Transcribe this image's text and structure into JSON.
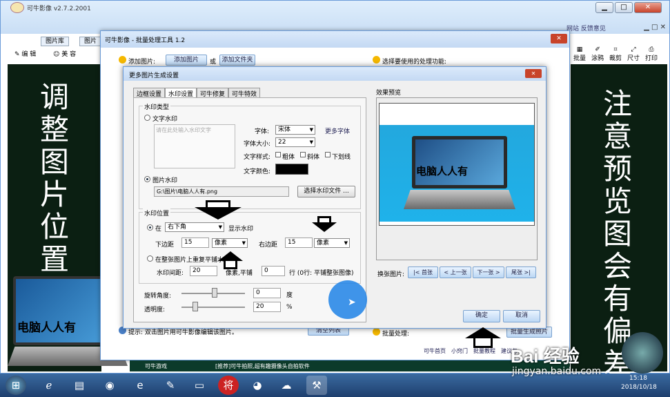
{
  "app": {
    "title": "可牛影像  v2.7.2.2001",
    "links": "网站 反馈意见",
    "controls": {
      "min": "▁",
      "max": "□",
      "close": "✕"
    }
  },
  "tabs": [
    "图片库",
    "图片"
  ],
  "tools": [
    "编 辑",
    "美 容"
  ],
  "right_tools": [
    "批量",
    "涂鸦",
    "裁剪",
    "尺寸",
    "打印"
  ],
  "left_panel": {
    "text": "调整图片位置"
  },
  "right_panel": {
    "text": "注意预览图会有偏差"
  },
  "watermark_text": "电脑人人有",
  "batch": {
    "title": "可牛影像 - 批量处理工具 1.2",
    "add_label": "添加图片:",
    "add_image_btn": "添加图片",
    "or": "或",
    "add_folder_btn": "添加文件夹",
    "choose_label": "选择要使用的处理功能:",
    "tip": "提示: 双击图片用可牛影像编辑该图片。",
    "clear_btn": "清空列表",
    "batch_label": "批量处理:",
    "batch_btn": "批量生成照片",
    "footer": [
      "可牛首页",
      "小窍门",
      "批量教程",
      "建议与"
    ]
  },
  "dialog": {
    "title": "更多图片生成设置",
    "tabs": [
      "边框设置",
      "水印设置",
      "可牛修复",
      "可牛特效"
    ],
    "wm_type": "水印类型",
    "text_wm": "文字水印",
    "text_placeholder": "请在此处输入水印文字",
    "font_lbl": "字体:",
    "font_val": "宋体",
    "more_font": "更多字体",
    "size_lbl": "字体大小:",
    "size_val": "22",
    "style_lbl": "文字样式:",
    "bold": "粗体",
    "italic": "斜体",
    "underline": "下划线",
    "color_lbl": "文字颜色:",
    "color": "#000000",
    "img_wm": "图片水印",
    "img_path": "G:\\图片\\电脑人人有.png",
    "choose_file": "选择水印文件 ...",
    "pos_lbl": "水印位置",
    "at": "在",
    "corner": "右下角",
    "show_wm": "显示水印",
    "bottom_lbl": "下边距",
    "bottom_val": "15",
    "unit1": "像素",
    "right_lbl": "右边距",
    "right_val": "15",
    "unit2": "像素",
    "tile_lbl": "在整张图片上重复平铺水印",
    "spacing_lbl": "水印间距:",
    "spacing_val": "20",
    "tile_unit": "像素,平铺",
    "tile_val": "0",
    "row_note": "行 (0行: 平铺整张图像)",
    "rotate_lbl": "旋转角度:",
    "rotate_val": "0",
    "deg": "度",
    "opacity_lbl": "透明度:",
    "opacity_val": "20",
    "pct": "%",
    "preview_lbl": "效果预览",
    "switch_lbl": "换张图片:",
    "nav": [
      "|< 首张",
      "< 上一张",
      "下一张 >",
      "尾张 >|"
    ],
    "ok": "确定",
    "cancel": "取消"
  },
  "ticker": "[推荐]可牛拍照,超有趣摄像头自拍软件",
  "games": "可牛游戏",
  "clock": {
    "time": "15:18",
    "date": "2018/10/18"
  },
  "site": "jingyan.baidu.com",
  "brand": "Bai 经验"
}
